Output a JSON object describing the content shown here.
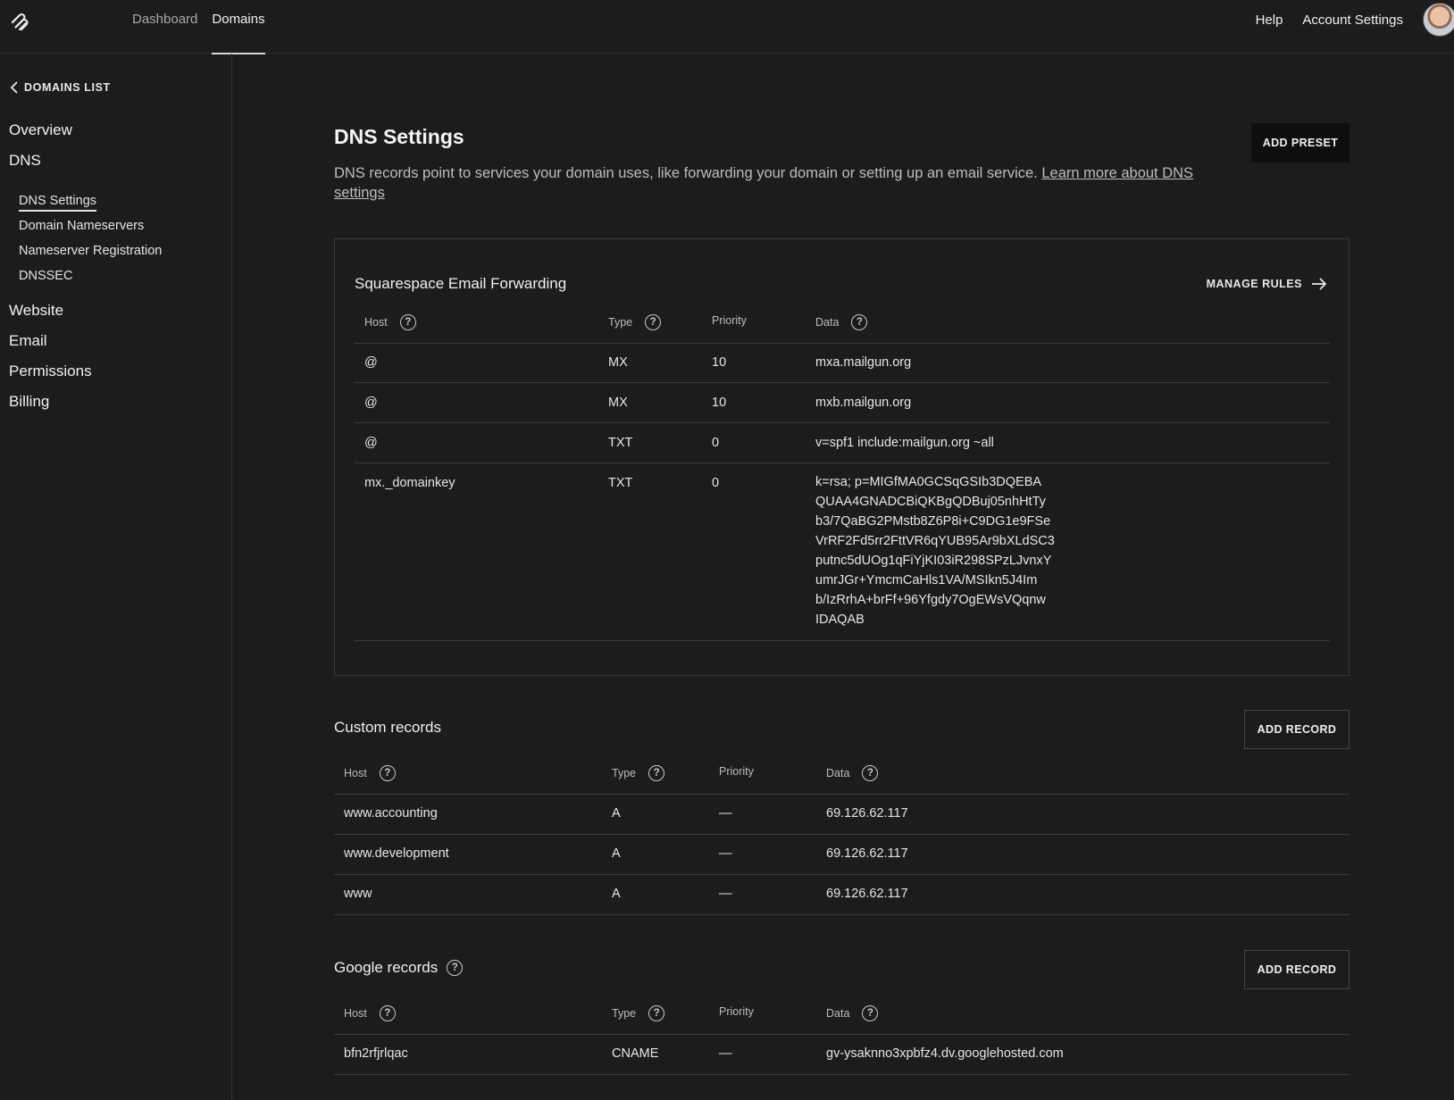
{
  "topbar": {
    "logo_icon": "squarespace-logo-icon",
    "nav": [
      {
        "label": "Dashboard",
        "active": false
      },
      {
        "label": "Domains",
        "active": true
      }
    ],
    "help": "Help",
    "account_settings": "Account Settings"
  },
  "sidebar": {
    "back_label": "DOMAINS LIST",
    "overview": "Overview",
    "dns": "DNS",
    "dns_items": [
      "DNS Settings",
      "Domain Nameservers",
      "Nameserver Registration",
      "DNSSEC"
    ],
    "website": "Website",
    "email": "Email",
    "permissions": "Permissions",
    "billing": "Billing"
  },
  "main": {
    "title": "DNS Settings",
    "description": "DNS records point to services your domain uses, like forwarding your domain or setting up an email service.",
    "learn_more": "Learn more about DNS settings",
    "add_preset": "ADD PRESET"
  },
  "email_forwarding": {
    "title": "Squarespace Email Forwarding",
    "manage_rules": "MANAGE RULES",
    "headers": {
      "host": "Host",
      "type": "Type",
      "priority": "Priority",
      "data": "Data"
    },
    "rows": [
      {
        "host": "@",
        "type": "MX",
        "priority": "10",
        "data": "mxa.mailgun.org"
      },
      {
        "host": "@",
        "type": "MX",
        "priority": "10",
        "data": "mxb.mailgun.org"
      },
      {
        "host": "@",
        "type": "TXT",
        "priority": "0",
        "data": "v=spf1 include:mailgun.org ~all"
      },
      {
        "host": "mx._domainkey",
        "type": "TXT",
        "priority": "0",
        "data_lines": [
          "k=rsa; p=MIGfMA0GCSqGSIb3DQEBA",
          "QUAA4GNADCBiQKBgQDBuj05nhHtTy",
          "b3/7QaBG2PMstb8Z6P8i+C9DG1e9FSe",
          "VrRF2Fd5rr2FttVR6qYUB95Ar9bXLdSC3",
          "putnc5dUOg1qFiYjKI03iR298SPzLJvnxY",
          "umrJGr+YmcmCaHls1VA/MSIkn5J4Im",
          "b/IzRrhA+brFf+96Yfgdy7OgEWsVQqnw",
          "IDAQAB"
        ]
      }
    ]
  },
  "custom_records": {
    "title": "Custom records",
    "add_record": "ADD RECORD",
    "headers": {
      "host": "Host",
      "type": "Type",
      "priority": "Priority",
      "data": "Data"
    },
    "rows": [
      {
        "host": "www.accounting",
        "type": "A",
        "priority": "—",
        "data": "69.126.62.117"
      },
      {
        "host": "www.development",
        "type": "A",
        "priority": "—",
        "data": "69.126.62.117"
      },
      {
        "host": "www",
        "type": "A",
        "priority": "—",
        "data": "69.126.62.117"
      }
    ]
  },
  "google_records": {
    "title": "Google records",
    "add_record": "ADD RECORD",
    "headers": {
      "host": "Host",
      "type": "Type",
      "priority": "Priority",
      "data": "Data"
    },
    "rows": [
      {
        "host": "bfn2rfjrlqac",
        "type": "CNAME",
        "priority": "—",
        "data": "gv-ysaknno3xpbfz4.dv.googlehosted.com"
      }
    ]
  }
}
